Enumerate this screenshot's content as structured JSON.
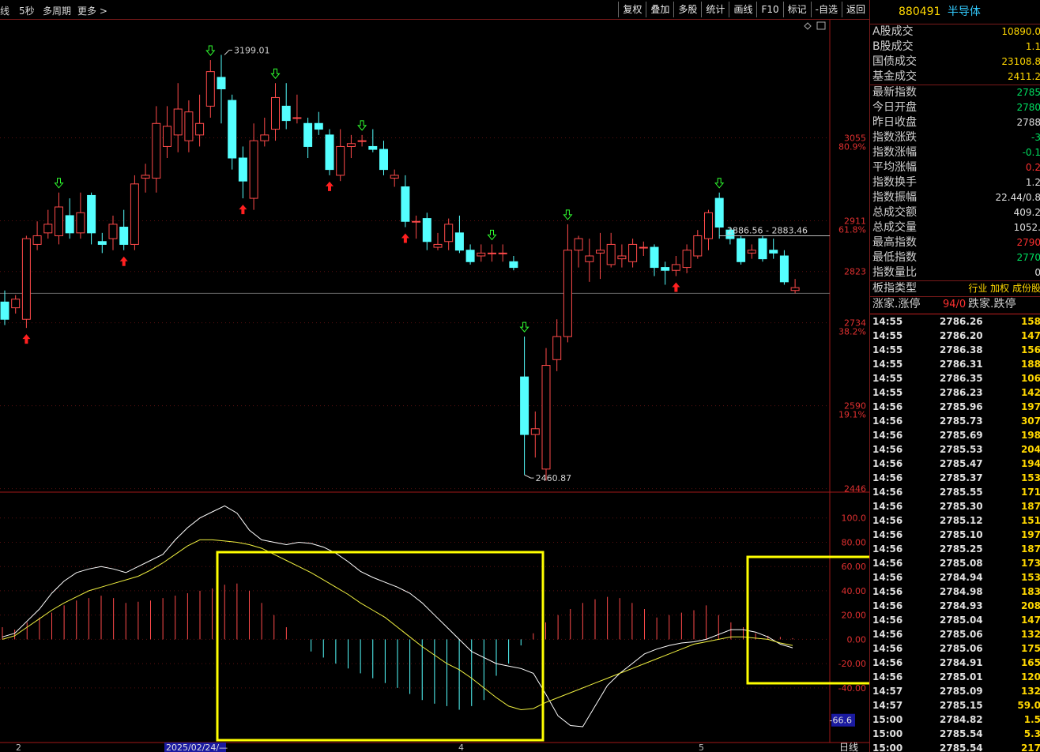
{
  "topbar": {
    "period_label": "线",
    "interval": "5秒",
    "multi_period": "多周期",
    "more": "更多 >",
    "tools": [
      "复权",
      "叠加",
      "多股",
      "统计",
      "画线",
      "F10",
      "标记",
      "-自选",
      "返回"
    ]
  },
  "panel": {
    "code": "880491",
    "name": "半导体",
    "summary": [
      {
        "k": "A股成交",
        "v": "10890.0"
      },
      {
        "k": "B股成交",
        "v": "1.1"
      },
      {
        "k": "国债成交",
        "v": "23108.8"
      },
      {
        "k": "基金成交",
        "v": "2411.2"
      }
    ],
    "quote": [
      {
        "k": "最新指数",
        "v": "2785"
      },
      {
        "k": "今日开盘",
        "v": "2780"
      },
      {
        "k": "昨日收盘",
        "v": "2788"
      },
      {
        "k": "指数涨跌",
        "v": "-3"
      },
      {
        "k": "指数涨幅",
        "v": "-0.1"
      },
      {
        "k": "平均涨幅",
        "v": "0.2"
      },
      {
        "k": "指数换手",
        "v": "1.2"
      },
      {
        "k": "指数振幅",
        "v": "22.44/0.8"
      },
      {
        "k": "总成交额",
        "v": "409.2"
      },
      {
        "k": "总成交量",
        "v": "1052."
      },
      {
        "k": "最高指数",
        "v": "2790"
      },
      {
        "k": "最低指数",
        "v": "2770"
      },
      {
        "k": "指数量比",
        "v": "0"
      }
    ],
    "type_label": "板指类型",
    "type_value": "行业 加权 成份股",
    "up_label": "涨家.涨停",
    "up_value": "94/0",
    "down_label": "跌家.跌停",
    "ticks": [
      [
        "14:55",
        "2786.26",
        "158"
      ],
      [
        "14:55",
        "2786.20",
        "147"
      ],
      [
        "14:55",
        "2786.38",
        "156"
      ],
      [
        "14:55",
        "2786.31",
        "188"
      ],
      [
        "14:55",
        "2786.35",
        "106"
      ],
      [
        "14:55",
        "2786.23",
        "142"
      ],
      [
        "14:56",
        "2785.96",
        "197"
      ],
      [
        "14:56",
        "2785.73",
        "307"
      ],
      [
        "14:56",
        "2785.69",
        "198"
      ],
      [
        "14:56",
        "2785.53",
        "204"
      ],
      [
        "14:56",
        "2785.47",
        "194"
      ],
      [
        "14:56",
        "2785.37",
        "153"
      ],
      [
        "14:56",
        "2785.55",
        "171"
      ],
      [
        "14:56",
        "2785.30",
        "187"
      ],
      [
        "14:56",
        "2785.12",
        "151"
      ],
      [
        "14:56",
        "2785.10",
        "197"
      ],
      [
        "14:56",
        "2785.25",
        "187"
      ],
      [
        "14:56",
        "2785.08",
        "173"
      ],
      [
        "14:56",
        "2784.94",
        "153"
      ],
      [
        "14:56",
        "2784.98",
        "183"
      ],
      [
        "14:56",
        "2784.93",
        "208"
      ],
      [
        "14:56",
        "2785.04",
        "147"
      ],
      [
        "14:56",
        "2785.06",
        "132"
      ],
      [
        "14:56",
        "2785.06",
        "175"
      ],
      [
        "14:56",
        "2784.91",
        "165"
      ],
      [
        "14:56",
        "2785.01",
        "120"
      ],
      [
        "14:57",
        "2785.09",
        "132"
      ],
      [
        "14:57",
        "2785.15",
        "59.0"
      ],
      [
        "15:00",
        "2784.82",
        "1.5"
      ],
      [
        "15:00",
        "2785.54",
        "5.3"
      ],
      [
        "15:00",
        "2785.54",
        "217"
      ]
    ]
  },
  "chart_data": [
    {
      "type": "candlestick",
      "price_axis": [
        "3055",
        "2911",
        "2823",
        "2734",
        "2590",
        "2446"
      ],
      "fib_labels": [
        "80.9%",
        "61.8%",
        "38.2%",
        "19.1%"
      ],
      "ylim": [
        2440,
        3260
      ],
      "high_marker": "3199.01",
      "low_marker": "2460.87",
      "range_label": "2886.56 - 2883.46",
      "last_price": 2785,
      "candles": [
        [
          2770,
          2740,
          2790,
          2730
        ],
        [
          2760,
          2775,
          2782,
          2750
        ],
        [
          2740,
          2880,
          2885,
          2725
        ],
        [
          2870,
          2885,
          2910,
          2860
        ],
        [
          2890,
          2905,
          2930,
          2880
        ],
        [
          2885,
          2935,
          2960,
          2870
        ],
        [
          2920,
          2890,
          2950,
          2880
        ],
        [
          2890,
          2925,
          2960,
          2880
        ],
        [
          2955,
          2890,
          2960,
          2870
        ],
        [
          2875,
          2870,
          2890,
          2855
        ],
        [
          2880,
          2905,
          2920,
          2860
        ],
        [
          2900,
          2870,
          2930,
          2860
        ],
        [
          2870,
          2975,
          2990,
          2860
        ],
        [
          2985,
          2990,
          3010,
          2960
        ],
        [
          2985,
          3080,
          3110,
          2960
        ],
        [
          3040,
          3075,
          3110,
          3020
        ],
        [
          3060,
          3105,
          3150,
          3030
        ],
        [
          3050,
          3100,
          3120,
          3030
        ],
        [
          3060,
          3080,
          3130,
          3040
        ],
        [
          3110,
          3170,
          3190,
          3090
        ],
        [
          3160,
          3140,
          3199,
          3080
        ],
        [
          3120,
          3020,
          3130,
          3000
        ],
        [
          3020,
          2980,
          3040,
          2950
        ],
        [
          2950,
          3050,
          3080,
          2930
        ],
        [
          3050,
          3060,
          3090,
          3040
        ],
        [
          3070,
          3125,
          3150,
          3050
        ],
        [
          3110,
          3085,
          3150,
          3070
        ],
        [
          3090,
          3090,
          3130,
          3080
        ],
        [
          3080,
          3040,
          3090,
          3020
        ],
        [
          3080,
          3070,
          3100,
          3060
        ],
        [
          3060,
          3000,
          3070,
          2990
        ],
        [
          2990,
          3040,
          3070,
          2980
        ],
        [
          3040,
          3045,
          3060,
          3020
        ],
        [
          3050,
          3050,
          3060,
          3040
        ],
        [
          3040,
          3035,
          3070,
          3030
        ],
        [
          3035,
          3000,
          3050,
          2990
        ],
        [
          2985,
          2990,
          3000,
          2970
        ],
        [
          2970,
          2910,
          2990,
          2900
        ],
        [
          2910,
          2910,
          2920,
          2880
        ],
        [
          2915,
          2875,
          2925,
          2860
        ],
        [
          2865,
          2870,
          2890,
          2860
        ],
        [
          2875,
          2905,
          2915,
          2860
        ],
        [
          2890,
          2860,
          2920,
          2855
        ],
        [
          2860,
          2840,
          2870,
          2835
        ],
        [
          2850,
          2855,
          2870,
          2840
        ],
        [
          2855,
          2855,
          2870,
          2840
        ],
        [
          2855,
          2855,
          2870,
          2840
        ],
        [
          2840,
          2830,
          2850,
          2825
        ],
        [
          2640,
          2540,
          2710,
          2470
        ],
        [
          2540,
          2550,
          2580,
          2500
        ],
        [
          2480,
          2660,
          2690,
          2460
        ],
        [
          2670,
          2710,
          2740,
          2650
        ],
        [
          2710,
          2860,
          2905,
          2700
        ],
        [
          2860,
          2880,
          2885,
          2830
        ],
        [
          2840,
          2850,
          2880,
          2805
        ],
        [
          2855,
          2860,
          2890,
          2810
        ],
        [
          2835,
          2870,
          2890,
          2830
        ],
        [
          2845,
          2850,
          2870,
          2830
        ],
        [
          2840,
          2870,
          2880,
          2830
        ],
        [
          2865,
          2865,
          2875,
          2850
        ],
        [
          2865,
          2830,
          2870,
          2815
        ],
        [
          2830,
          2825,
          2840,
          2800
        ],
        [
          2825,
          2835,
          2850,
          2815
        ],
        [
          2830,
          2860,
          2870,
          2820
        ],
        [
          2850,
          2885,
          2895,
          2845
        ],
        [
          2880,
          2925,
          2930,
          2860
        ],
        [
          2950,
          2900,
          2960,
          2880
        ],
        [
          2895,
          2880,
          2900,
          2870
        ],
        [
          2880,
          2840,
          2885,
          2835
        ],
        [
          2855,
          2860,
          2870,
          2845
        ],
        [
          2880,
          2845,
          2885,
          2840
        ],
        [
          2860,
          2855,
          2880,
          2845
        ],
        [
          2850,
          2805,
          2860,
          2800
        ],
        [
          2790,
          2795,
          2810,
          2785
        ]
      ]
    },
    {
      "type": "macd",
      "axis_labels": [
        "100.0",
        "80.00",
        "60.00",
        "40.00",
        "20.00",
        "0.00",
        "-20.00",
        "-40.00"
      ],
      "ylim": [
        -85,
        120
      ],
      "current_label": "-66.6",
      "dif": [
        2,
        5,
        15,
        25,
        38,
        48,
        55,
        58,
        60,
        58,
        55,
        60,
        65,
        70,
        82,
        92,
        100,
        105,
        110,
        104,
        90,
        82,
        80,
        78,
        80,
        79,
        76,
        71,
        64,
        56,
        51,
        47,
        43,
        38,
        30,
        20,
        10,
        0,
        -10,
        -15,
        -20,
        -22,
        -24,
        -28,
        -45,
        -63,
        -71,
        -72,
        -55,
        -38,
        -28,
        -20,
        -12,
        -8,
        -5,
        -3,
        -2,
        0,
        4,
        8,
        8,
        6,
        2,
        -4,
        -7
      ],
      "dea": [
        0,
        3,
        10,
        17,
        24,
        30,
        35,
        40,
        43,
        46,
        49,
        52,
        57,
        63,
        70,
        77,
        82,
        82,
        81,
        80,
        78,
        75,
        70,
        65,
        60,
        55,
        49,
        43,
        37,
        30,
        24,
        18,
        10,
        2,
        -6,
        -13,
        -20,
        -25,
        -32,
        -40,
        -48,
        -55,
        -58,
        -57,
        -52,
        -48,
        -44,
        -40,
        -36,
        -32,
        -28,
        -24,
        -20,
        -16,
        -12,
        -8,
        -4,
        -2,
        0,
        2,
        2,
        1,
        0,
        -3,
        -5
      ],
      "hist": [
        10,
        8,
        14,
        18,
        22,
        28,
        32,
        34,
        36,
        34,
        30,
        31,
        32,
        34,
        36,
        38,
        40,
        42,
        45,
        46,
        40,
        30,
        20,
        10,
        0,
        -10,
        -15,
        -20,
        -24,
        -28,
        -32,
        -36,
        -40,
        -45,
        -50,
        -53,
        -55,
        -58,
        -55,
        -50,
        -30,
        -20,
        -5,
        5,
        14,
        20,
        25,
        30,
        33,
        35,
        34,
        30,
        25,
        18,
        20,
        22,
        24,
        28,
        20,
        14,
        10,
        5,
        3,
        2,
        1
      ]
    }
  ],
  "date_labels": [
    "2",
    "2025/02/24/—",
    "4",
    "5",
    "日线"
  ]
}
